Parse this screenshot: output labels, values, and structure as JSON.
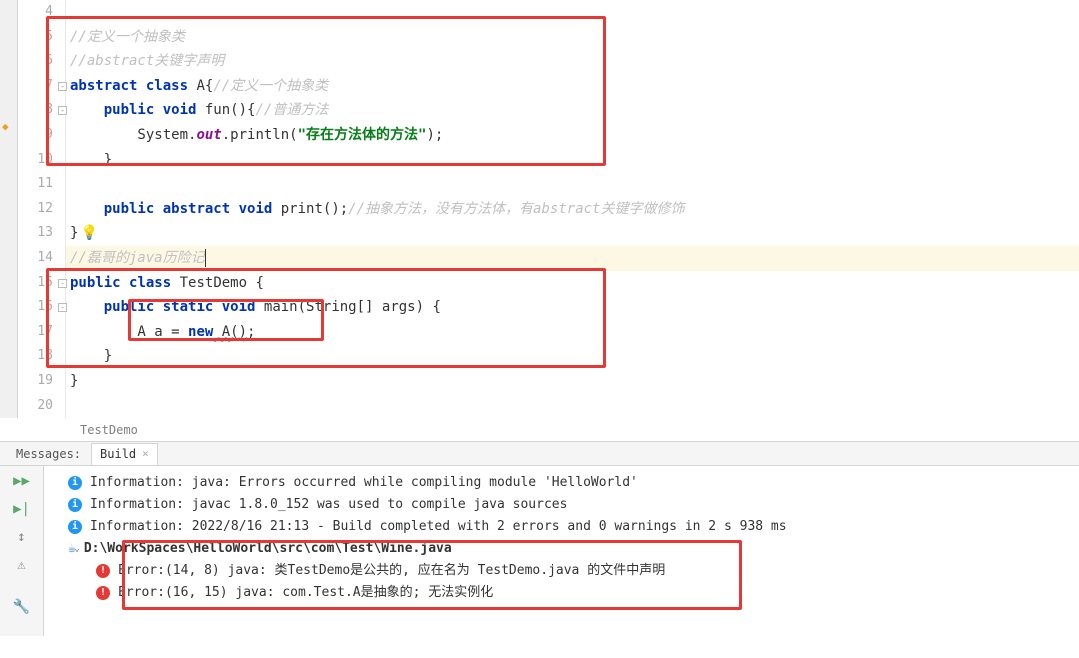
{
  "gutter": {
    "start": 4,
    "end": 20
  },
  "code": {
    "l4": "",
    "l5_comment": "//定义一个抽象类",
    "l6_comment": "//abstract关键字声明",
    "l7_kw1": "abstract",
    "l7_kw2": "class",
    "l7_name": " A{",
    "l7_comment": "//定义一个抽象类",
    "l8_kw1": "public",
    "l8_kw2": "void",
    "l8_name": " fun(){",
    "l8_comment": "//普通方法",
    "l9_pre": "        System.",
    "l9_out": "out",
    "l9_mid": ".println(",
    "l9_str": "\"存在方法体的方法\"",
    "l9_post": ");",
    "l10": "    }",
    "l11": "",
    "l12_kw1": "public",
    "l12_kw2": "abstract",
    "l12_kw3": "void",
    "l12_name": " print();",
    "l12_comment": "//抽象方法，没有方法体，有abstract关键字做修饰",
    "l13": "}",
    "l14_comment": "//磊哥的java历险记",
    "l15_kw1": "public",
    "l15_kw2": "class",
    "l15_name": " TestDemo {",
    "l16_kw1": "public",
    "l16_kw2": "static",
    "l16_kw3": "void",
    "l16_name": " main(String[] args) {",
    "l17_pre": "        A a = ",
    "l17_kw": "new",
    "l17_err": " A()",
    "l17_post": ";",
    "l18": "    }",
    "l19": "}",
    "l20": ""
  },
  "breadcrumb": "TestDemo",
  "messages": {
    "label": "Messages:",
    "tab": "Build",
    "info1": "Information: java: Errors occurred while compiling module 'HelloWorld'",
    "info2": "Information: javac 1.8.0_152 was used to compile java sources",
    "info3": "Information: 2022/8/16 21:13 - Build completed with 2 errors and 0 warnings in 2 s 938 ms",
    "file": "D:\\WorkSpaces\\HelloWorld\\src\\com\\Test\\Wine.java",
    "err1": "Error:(14, 8)  java: 类TestDemo是公共的, 应在名为 TestDemo.java 的文件中声明",
    "err2": "Error:(16, 15)  java: com.Test.A是抽象的; 无法实例化"
  },
  "icons": {
    "run": "▶▶",
    "stop": "▶|",
    "expand": "↕",
    "warn": "⚠",
    "wrench": "🔧"
  }
}
